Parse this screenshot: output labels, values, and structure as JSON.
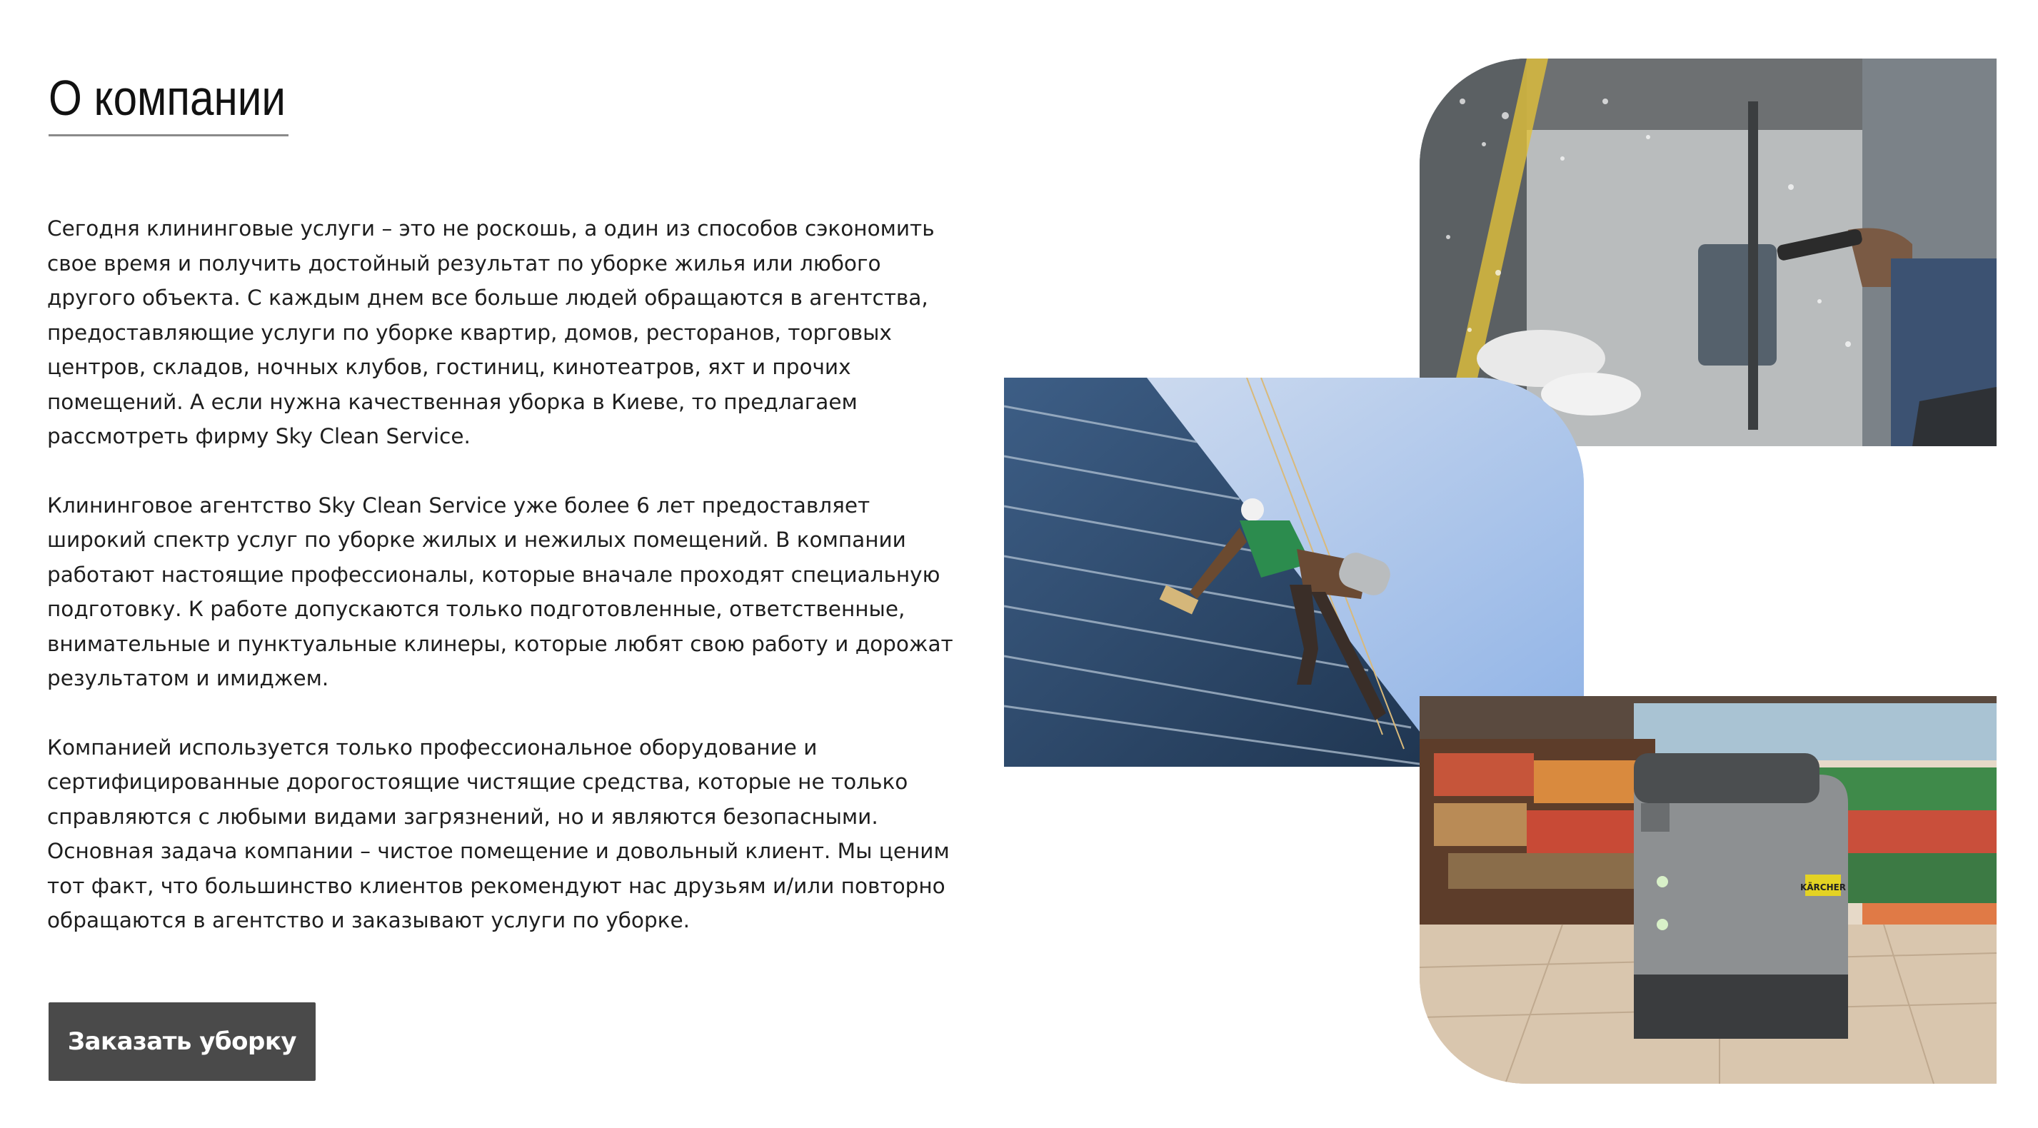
{
  "section": {
    "title": "О компании",
    "paragraphs": [
      "Сегодня клининговые услуги – это не роскошь, а один из способов сэкономить свое время и получить достойный результат по уборке жилья или любого другого объекта. С каждым днем все больше людей обращаются в агентства, предоставляющие услуги по уборке квартир, домов, ресторанов, торговых центров, складов, ночных клубов, гостиниц, кинотеатров, яхт и прочих помещений. А если нужна качественная уборка в Киеве, то предлагаем рассмотреть фирму Sky Clean Service.",
      "Клининговое агентство Sky Clean Service уже более 6 лет предоставляет широкий спектр услуг по уборке жилых и нежилых помещений. В компании работают настоящие профессионалы, которые вначале проходят специальную подготовку. К работе допускаются только подготовленные, ответственные, внимательные и пунктуальные клинеры, которые любят свою работу и дорожат результатом и имиджем.",
      "Компанией используется только профессиональное оборудование и сертифицированные дорогостоящие чистящие средства, которые не только справляются с любыми видами загрязнений, но и являются безопасными. Основная задача компании – чистое помещение и довольный клиент. Мы ценим тот факт, что большинство клиентов рекомендуют нас друзьям и/или повторно обращаются в агентство и заказывают услуги по уборке."
    ],
    "cta_label": "Заказать уборку"
  },
  "images": {
    "window_squeegee": "window-squeegee-photo",
    "facade_climber": "facade-climber-photo",
    "floor_scrubber": "floor-scrubber-photo",
    "machine_brand": "KÄRCHER"
  },
  "colors": {
    "button_bg": "#4a4a4a",
    "button_text": "#ffffff",
    "underline": "#8a8a8a",
    "text": "#1e1e1e"
  }
}
